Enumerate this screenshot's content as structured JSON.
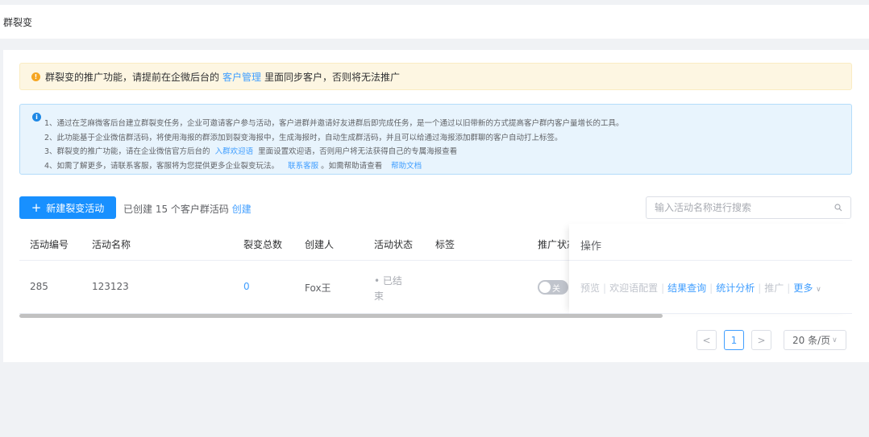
{
  "page": {
    "title": "群裂变"
  },
  "warning": {
    "prefix": "群裂变的推广功能，请提前在企微后台的",
    "link": "客户管理",
    "suffix": "里面同步客户，否则将无法推广"
  },
  "info": {
    "line1": "1、通过在芝麻微客后台建立群裂变任务，企业可邀请客户参与活动，客户进群并邀请好友进群后即完成任务，是一个通过以旧带新的方式提高客户群内客户量增长的工具。",
    "line2": "2、此功能基于企业微信群活码，将使用海报的群添加到裂变海报中，生成海报时，自动生成群活码，并且可以给通过海报添加群聊的客户自动打上标签。",
    "line3_prefix": "3、群裂变的推广功能，请在企业微信官方后台的",
    "line3_link": "入群欢迎语",
    "line3_suffix": "里面设置欢迎语，否则用户将无法获得自己的专属海报查看",
    "line4_prefix": "4、如需了解更多，请联系客服，客服将为您提供更多企业裂变玩法。",
    "line4_link1": "联系客服",
    "line4_middle": "。如需帮助请查看",
    "line4_link2": "帮助文档"
  },
  "toolbar": {
    "create_label": "新建裂变活动",
    "created_prefix": "已创建 15 个客户群活码",
    "created_link": "创建",
    "search_placeholder": "输入活动名称进行搜索"
  },
  "table": {
    "columns": [
      "活动编号",
      "活动名称",
      "裂变总数",
      "创建人",
      "活动状态",
      "标签",
      "推广状态",
      "操作"
    ],
    "rows": [
      {
        "id": "285",
        "name": "123123",
        "total": "0",
        "creator": "Fox王",
        "status_line1": "• 已结",
        "status_line2": "束",
        "tag": "",
        "toggle_text": "关"
      }
    ],
    "ops": {
      "preview": "预览",
      "welcome": "欢迎语配置",
      "result": "结果查询",
      "stats": "统计分析",
      "promote": "推广",
      "more": "更多"
    }
  },
  "pagination": {
    "prev": "<",
    "current": "1",
    "next": ">",
    "page_size": "20 条/页"
  },
  "colors": {
    "primary": "#1890ff",
    "link": "#409eff",
    "warning_bg": "#fdf6e2",
    "info_bg": "#e8f4fd"
  }
}
